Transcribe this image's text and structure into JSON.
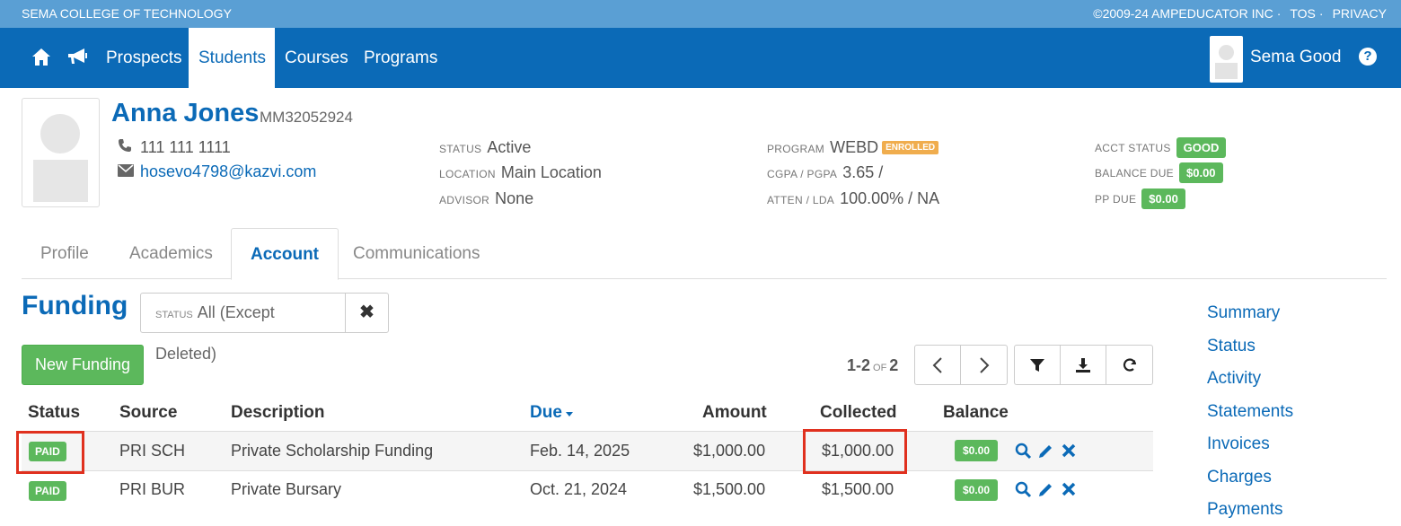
{
  "topbar": {
    "school": "SEMA COLLEGE OF TECHNOLOGY",
    "copyright": "©2009-24 AMPEDUCATOR INC",
    "tos": "TOS",
    "privacy": "PRIVACY",
    "separator": "·"
  },
  "nav": {
    "home_icon": "home-icon",
    "announce_icon": "megaphone-icon",
    "items": [
      "Prospects",
      "Students",
      "Courses",
      "Programs"
    ],
    "active": "Students",
    "user_name": "Sema Good",
    "help_glyph": "?"
  },
  "student": {
    "name": "Anna Jones",
    "id": "MM32052924",
    "phone": "111 111 1111",
    "email": "hosevo4798@kazvi.com",
    "status_label": "STATUS",
    "status": "Active",
    "location_label": "LOCATION",
    "location": "Main Location",
    "advisor_label": "ADVISOR",
    "advisor": "None",
    "program_label": "PROGRAM",
    "program": "WEBD",
    "program_badge": "ENROLLED",
    "gpa_label": "CGPA / PGPA",
    "gpa": "3.65 /",
    "atten_label": "ATTEN / LDA",
    "atten": "100.00% / NA",
    "acct_status_label": "ACCT STATUS",
    "acct_status": "GOOD",
    "balance_due_label": "BALANCE DUE",
    "balance_due": "$0.00",
    "pp_due_label": "PP DUE",
    "pp_due": "$0.00"
  },
  "tabs": [
    "Profile",
    "Academics",
    "Account",
    "Communications"
  ],
  "active_tab": "Account",
  "funding": {
    "title": "Funding",
    "filter_label": "STATUS",
    "filter_value": "All (Except Deleted)",
    "clear_glyph": "✖",
    "new_button": "New Funding",
    "pager_range": "1-2",
    "pager_of": "OF",
    "pager_total": "2",
    "columns": {
      "status": "Status",
      "source": "Source",
      "description": "Description",
      "due": "Due",
      "amount": "Amount",
      "collected": "Collected",
      "balance": "Balance"
    },
    "rows": [
      {
        "status": "PAID",
        "source": "PRI SCH",
        "description": "Private Scholarship Funding",
        "due": "Feb. 14, 2025",
        "amount": "$1,000.00",
        "collected": "$1,000.00",
        "balance": "$0.00"
      },
      {
        "status": "PAID",
        "source": "PRI BUR",
        "description": "Private Bursary",
        "due": "Oct. 21, 2024",
        "amount": "$1,500.00",
        "collected": "$1,500.00",
        "balance": "$0.00"
      }
    ]
  },
  "sidenav": [
    "Summary",
    "Status",
    "Activity",
    "Statements",
    "Invoices",
    "Charges",
    "Payments"
  ],
  "colors": {
    "primary": "#0b6ab7",
    "topstrip": "#5a9fd4",
    "success": "#5cb85c",
    "warning": "#f0ad4e",
    "highlight": "#e0301e"
  }
}
